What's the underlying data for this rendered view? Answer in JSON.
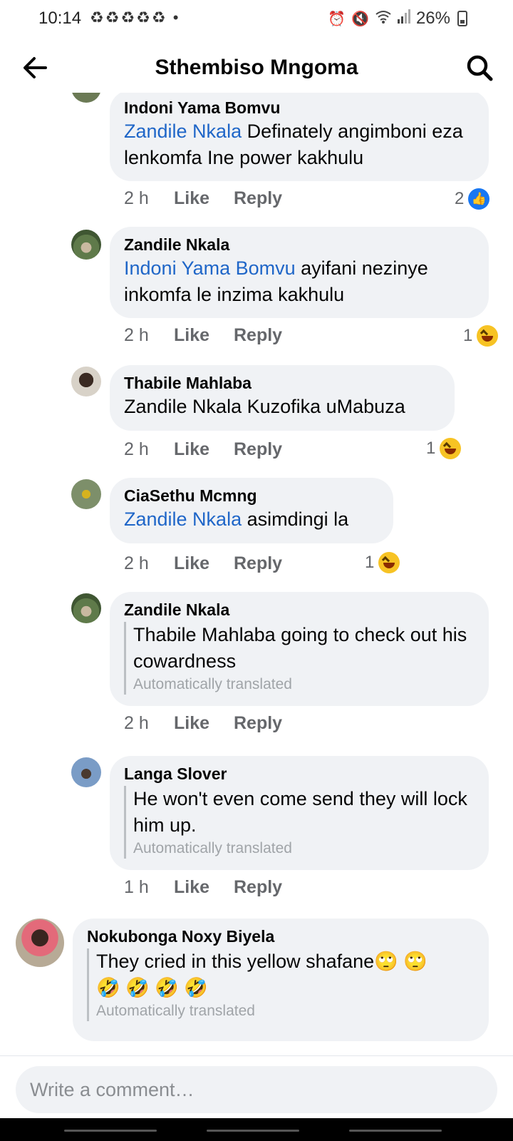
{
  "status": {
    "time": "10:14",
    "notifications": "♻♻♻♻♻ •",
    "battery": "26%"
  },
  "header": {
    "title": "Sthembiso Mngoma"
  },
  "comments": [
    {
      "author": "Indoni Yama Bomvu",
      "mention": "Zandile Nkala",
      "text": " Definately angimboni eza lenkomfa Ine power kakhulu",
      "time": "2 h",
      "like": "Like",
      "reply": "Reply",
      "reaction_count": "2",
      "reaction_type": "like"
    },
    {
      "author": "Zandile Nkala",
      "mention": "Indoni Yama Bomvu",
      "text": " ayifani nezinye inkomfa le inzima kakhulu",
      "time": "2 h",
      "like": "Like",
      "reply": "Reply",
      "reaction_count": "1",
      "reaction_type": "haha"
    },
    {
      "author": "Thabile Mahlaba",
      "mention": "",
      "text": "Zandile Nkala Kuzofika uMabuza",
      "time": "2 h",
      "like": "Like",
      "reply": "Reply",
      "reaction_count": "1",
      "reaction_type": "haha"
    },
    {
      "author": "CiaSethu Mcmng",
      "mention": "Zandile Nkala",
      "text": " asimdingi la",
      "time": "2 h",
      "like": "Like",
      "reply": "Reply",
      "reaction_count": "1",
      "reaction_type": "haha"
    },
    {
      "author": "Zandile Nkala",
      "text": "Thabile Mahlaba going to check out his cowardness",
      "translated_note": "Automatically translated",
      "time": "2 h",
      "like": "Like",
      "reply": "Reply"
    },
    {
      "author": "Langa Slover",
      "text": "He won't even come send they will lock him up.",
      "translated_note": "Automatically translated",
      "time": "1 h",
      "like": "Like",
      "reply": "Reply"
    },
    {
      "author": "Nokubonga Noxy Biyela",
      "text": "They cried in this yellow shafane🙄 🙄",
      "text2": "🤣 🤣 🤣 🤣",
      "translated_note": "Automatically translated"
    }
  ],
  "composer": {
    "placeholder": "Write a comment…"
  },
  "colors": {
    "mention": "#1f66c8",
    "bubble": "#f0f2f5",
    "meta": "#65676b"
  }
}
